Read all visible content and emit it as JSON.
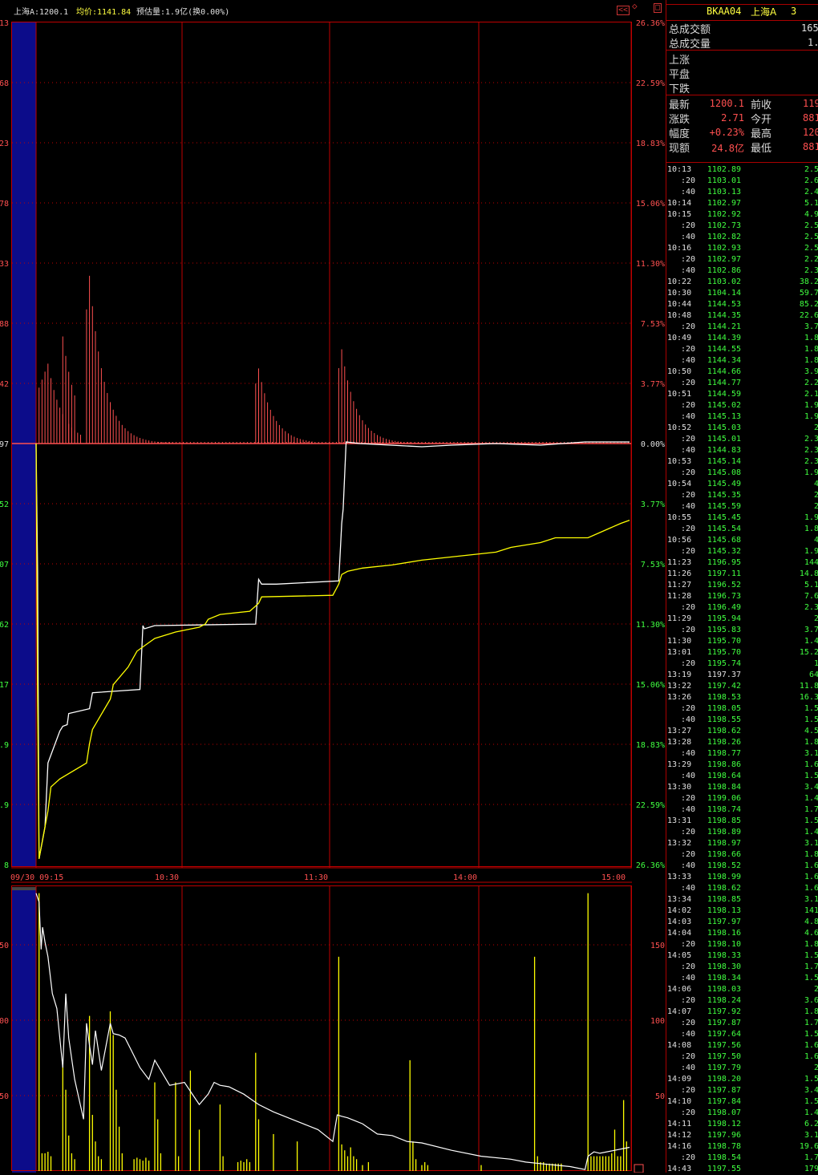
{
  "header": {
    "index_label": "上海A:1200.1",
    "avg_label": "均价:1141.84",
    "estimate_label": "预估量:1.9亿(换0.00%)",
    "collapse_btn": "<<",
    "toggle_btn": "◇",
    "max_btn": "□"
  },
  "colors": {
    "background": "#000000",
    "grid": "#c00000",
    "price_line": "#ffffff",
    "avg_line": "#ffff00",
    "up": "#ff5050",
    "down": "#40ff40",
    "highlight_band": "#0c0c8a"
  },
  "chart_data": [
    {
      "type": "line",
      "name": "price-chart",
      "x_ticks": [
        "09/30 09:15",
        "10:30",
        "11:30",
        "14:00",
        "15:00"
      ],
      "left_ticks": [
        "13",
        "68",
        "23",
        "78",
        "33",
        "88",
        "42",
        "97",
        "52",
        "07",
        "62",
        "17",
        ".9",
        ".9",
        "8"
      ],
      "right_ticks": [
        "26.36%",
        "22.59%",
        "18.83%",
        "15.06%",
        "11.30%",
        "7.53%",
        "3.77%",
        "0.00%",
        "3.77%",
        "7.53%",
        "11.30%",
        "15.06%",
        "18.83%",
        "22.59%",
        "26.36%"
      ],
      "right_tick_colors": [
        "up",
        "up",
        "up",
        "up",
        "up",
        "up",
        "up",
        "flat",
        "down",
        "down",
        "down",
        "down",
        "down",
        "down",
        "down"
      ],
      "pct_range": [
        -26.36,
        26.36
      ],
      "series": [
        {
          "role": "price",
          "t": [
            0,
            0.5,
            1,
            3,
            4,
            8,
            9,
            10.5,
            11,
            18,
            19,
            35,
            36,
            36.5,
            40,
            74,
            75,
            76,
            81,
            102,
            103,
            103.5,
            104.5,
            109,
            130,
            140,
            155,
            170,
            185,
            200
          ],
          "pct": [
            0,
            -8,
            -26,
            -24,
            -20,
            -18,
            -17.7,
            -17.6,
            -16.9,
            -16.6,
            -15.6,
            -15.4,
            -11.4,
            -11.6,
            -11.4,
            -11.3,
            -8.5,
            -8.8,
            -8.8,
            -8.6,
            -5.0,
            -4.1,
            0.1,
            0,
            -0.2,
            -0.1,
            0,
            -0.1,
            0.1,
            0.1
          ],
          "color": "white"
        },
        {
          "role": "average",
          "t": [
            0,
            0.5,
            1,
            4,
            5,
            8,
            17,
            18,
            19,
            25,
            25.5,
            26,
            31,
            34,
            37,
            40,
            47,
            55,
            57,
            58,
            62,
            72,
            75,
            76,
            100,
            102,
            103,
            105,
            110,
            120,
            130,
            145,
            155,
            160,
            170,
            175,
            182,
            186,
            197,
            200
          ],
          "pct": [
            0,
            -16,
            -26,
            -23,
            -21.5,
            -21,
            -20,
            -18.8,
            -17.9,
            -16,
            -15.6,
            -15.1,
            -14,
            -13,
            -12.6,
            -12.2,
            -11.8,
            -11.5,
            -11.3,
            -11.0,
            -10.7,
            -10.5,
            -10.0,
            -9.6,
            -9.5,
            -8.8,
            -8.2,
            -8.0,
            -7.8,
            -7.6,
            -7.3,
            -7.0,
            -6.8,
            -6.5,
            -6.2,
            -5.9,
            -5.9,
            -5.9,
            -5.0,
            -4.8
          ],
          "color": "yellow"
        },
        {
          "role": "breadth-bars",
          "groups": [
            {
              "t0": 1,
              "peak_t": 4,
              "peak": 5.0,
              "n": 15
            },
            {
              "t0": 9,
              "peak_t": 9,
              "peak": 6.7,
              "n": 5
            },
            {
              "t0": 17,
              "peak_t": 18,
              "peak": 10.5,
              "n": 30
            },
            {
              "t0": 74,
              "peak_t": 75,
              "peak": 4.7,
              "n": 20
            },
            {
              "t0": 102,
              "peak_t": 103,
              "peak": 5.9,
              "n": 25
            }
          ]
        }
      ]
    },
    {
      "type": "bar",
      "name": "volume-chart",
      "left_ticks": [
        "50",
        "00",
        "50"
      ],
      "right_ticks": [
        "150",
        "100",
        "50"
      ],
      "ylim": [
        0,
        190
      ],
      "volume_bars": [
        {
          "t": 1,
          "v": 188
        },
        {
          "t": 2,
          "v": 12
        },
        {
          "t": 3,
          "v": 12
        },
        {
          "t": 4,
          "v": 13
        },
        {
          "t": 5,
          "v": 10
        },
        {
          "t": 9,
          "v": 75
        },
        {
          "t": 10,
          "v": 55
        },
        {
          "t": 11,
          "v": 24
        },
        {
          "t": 12,
          "v": 12
        },
        {
          "t": 13,
          "v": 8
        },
        {
          "t": 18,
          "v": 105
        },
        {
          "t": 19,
          "v": 38
        },
        {
          "t": 20,
          "v": 20
        },
        {
          "t": 21,
          "v": 10
        },
        {
          "t": 22,
          "v": 8
        },
        {
          "t": 25,
          "v": 108
        },
        {
          "t": 26,
          "v": 92
        },
        {
          "t": 27,
          "v": 55
        },
        {
          "t": 28,
          "v": 30
        },
        {
          "t": 29,
          "v": 12
        },
        {
          "t": 33,
          "v": 8
        },
        {
          "t": 34,
          "v": 9
        },
        {
          "t": 35,
          "v": 8
        },
        {
          "t": 36,
          "v": 7
        },
        {
          "t": 37,
          "v": 9
        },
        {
          "t": 38,
          "v": 7
        },
        {
          "t": 40,
          "v": 60
        },
        {
          "t": 41,
          "v": 35
        },
        {
          "t": 42,
          "v": 12
        },
        {
          "t": 47,
          "v": 60
        },
        {
          "t": 48,
          "v": 10
        },
        {
          "t": 52,
          "v": 68
        },
        {
          "t": 55,
          "v": 28
        },
        {
          "t": 62,
          "v": 45
        },
        {
          "t": 63,
          "v": 10
        },
        {
          "t": 68,
          "v": 6
        },
        {
          "t": 69,
          "v": 7
        },
        {
          "t": 70,
          "v": 6
        },
        {
          "t": 71,
          "v": 8
        },
        {
          "t": 72,
          "v": 6
        },
        {
          "t": 74,
          "v": 80
        },
        {
          "t": 75,
          "v": 35
        },
        {
          "t": 80,
          "v": 25
        },
        {
          "t": 88,
          "v": 20
        },
        {
          "t": 102,
          "v": 145
        },
        {
          "t": 103,
          "v": 18
        },
        {
          "t": 104,
          "v": 14
        },
        {
          "t": 105,
          "v": 10
        },
        {
          "t": 106,
          "v": 16
        },
        {
          "t": 107,
          "v": 10
        },
        {
          "t": 108,
          "v": 8
        },
        {
          "t": 110,
          "v": 4
        },
        {
          "t": 112,
          "v": 6
        },
        {
          "t": 126,
          "v": 75
        },
        {
          "t": 127,
          "v": 20
        },
        {
          "t": 128,
          "v": 8
        },
        {
          "t": 130,
          "v": 4
        },
        {
          "t": 131,
          "v": 6
        },
        {
          "t": 132,
          "v": 4
        },
        {
          "t": 150,
          "v": 4
        },
        {
          "t": 168,
          "v": 145
        },
        {
          "t": 169,
          "v": 10
        },
        {
          "t": 170,
          "v": 6
        },
        {
          "t": 171,
          "v": 6
        },
        {
          "t": 172,
          "v": 5
        },
        {
          "t": 173,
          "v": 5
        },
        {
          "t": 174,
          "v": 5
        },
        {
          "t": 175,
          "v": 5
        },
        {
          "t": 176,
          "v": 5
        },
        {
          "t": 177,
          "v": 5
        },
        {
          "t": 186,
          "v": 188
        },
        {
          "t": 187,
          "v": 10
        },
        {
          "t": 188,
          "v": 10
        },
        {
          "t": 189,
          "v": 10
        },
        {
          "t": 190,
          "v": 10
        },
        {
          "t": 191,
          "v": 10
        },
        {
          "t": 192,
          "v": 10
        },
        {
          "t": 193,
          "v": 10
        },
        {
          "t": 194,
          "v": 12
        },
        {
          "t": 195,
          "v": 28
        },
        {
          "t": 196,
          "v": 10
        },
        {
          "t": 197,
          "v": 10
        },
        {
          "t": 198,
          "v": 48
        },
        {
          "t": 199,
          "v": 20
        }
      ],
      "vol_line": {
        "t": [
          0,
          1,
          1.7,
          2.2,
          3,
          4,
          5.5,
          7,
          9,
          10,
          11,
          13,
          16,
          17,
          18,
          19,
          20,
          22,
          25,
          26,
          28,
          30,
          32,
          35,
          38,
          40,
          45,
          50,
          55,
          58,
          60,
          62,
          65,
          67,
          70,
          75,
          80,
          90,
          95,
          100,
          101.5,
          103,
          105,
          110,
          115,
          120,
          125,
          130,
          140,
          150,
          160,
          165,
          170,
          180,
          185,
          186,
          188,
          190,
          195,
          200
        ],
        "v": [
          188,
          182,
          150,
          165,
          155,
          145,
          120,
          110,
          70,
          120,
          90,
          62,
          35,
          100,
          85,
          72,
          95,
          68,
          100,
          93,
          92,
          90,
          82,
          70,
          62,
          75,
          58,
          60,
          45,
          52,
          60,
          58,
          57,
          55,
          52,
          45,
          40,
          32,
          28,
          20,
          38,
          37,
          36,
          32,
          25,
          24,
          20,
          19,
          14,
          10,
          8,
          6,
          5,
          3,
          1,
          10,
          13,
          12,
          14,
          16
        ]
      }
    }
  ],
  "right_panel": {
    "code": "BKAA04",
    "market": "上海A",
    "page": "3",
    "total_amount_label": "总成交额",
    "total_amount_value": "165",
    "total_volume_label": "总成交量",
    "total_volume_value": "1.",
    "up_label": "上涨",
    "flat_label": "平盘",
    "down_label": "下跌",
    "quotes": [
      {
        "label": "最新",
        "value": "1200.1",
        "label2": "前收",
        "value2": "119"
      },
      {
        "label": "涨跌",
        "value": "2.71",
        "label2": "今开",
        "value2": "881"
      },
      {
        "label": "幅度",
        "value": "+0.23%",
        "label2": "最高",
        "value2": "120"
      },
      {
        "label": "现额",
        "value": "24.8亿",
        "label2": "最低",
        "value2": "881"
      }
    ],
    "ticks": [
      [
        "10:13",
        "1102.89",
        "2.5"
      ],
      [
        ":20",
        "1103.01",
        "2.6"
      ],
      [
        ":40",
        "1103.13",
        "2.4"
      ],
      [
        "10:14",
        "1102.97",
        "5.1"
      ],
      [
        "10:15",
        "1102.92",
        "4.9"
      ],
      [
        ":20",
        "1102.73",
        "2.5"
      ],
      [
        ":40",
        "1102.82",
        "2.5"
      ],
      [
        "10:16",
        "1102.93",
        "2.5"
      ],
      [
        ":20",
        "1102.97",
        "2.2"
      ],
      [
        ":40",
        "1102.86",
        "2.3"
      ],
      [
        "10:22",
        "1103.02",
        "38.2"
      ],
      [
        "10:30",
        "1104.14",
        "59.7"
      ],
      [
        "10:44",
        "1144.53",
        "85.2"
      ],
      [
        "10:48",
        "1144.35",
        "22.6"
      ],
      [
        ":20",
        "1144.21",
        "3.7"
      ],
      [
        "10:49",
        "1144.39",
        "1.8"
      ],
      [
        ":20",
        "1144.55",
        "1.8"
      ],
      [
        ":40",
        "1144.34",
        "1.8"
      ],
      [
        "10:50",
        "1144.66",
        "3.9"
      ],
      [
        ":20",
        "1144.77",
        "2.2"
      ],
      [
        "10:51",
        "1144.59",
        "2.1"
      ],
      [
        ":20",
        "1145.02",
        "1.9"
      ],
      [
        ":40",
        "1145.13",
        "1.9"
      ],
      [
        "10:52",
        "1145.03",
        "2"
      ],
      [
        ":20",
        "1145.01",
        "2.3"
      ],
      [
        ":40",
        "1144.83",
        "2.3"
      ],
      [
        "10:53",
        "1145.14",
        "2.3"
      ],
      [
        ":20",
        "1145.08",
        "1.9"
      ],
      [
        "10:54",
        "1145.49",
        "4"
      ],
      [
        ":20",
        "1145.35",
        "2"
      ],
      [
        ":40",
        "1145.59",
        "2"
      ],
      [
        "10:55",
        "1145.45",
        "1.9"
      ],
      [
        ":20",
        "1145.54",
        "1.8"
      ],
      [
        "10:56",
        "1145.68",
        "4"
      ],
      [
        ":20",
        "1145.32",
        "1.9"
      ],
      [
        "11:23",
        "1196.95",
        "144"
      ],
      [
        "11:26",
        "1197.11",
        "14.8"
      ],
      [
        "11:27",
        "1196.52",
        "5.1"
      ],
      [
        "11:28",
        "1196.73",
        "7.6"
      ],
      [
        ":20",
        "1196.49",
        "2.3"
      ],
      [
        "11:29",
        "1195.94",
        "2"
      ],
      [
        ":20",
        "1195.83",
        "3.7"
      ],
      [
        "11:30",
        "1195.70",
        "1.4"
      ],
      [
        "13:01",
        "1195.70",
        "15.2"
      ],
      [
        ":20",
        "1195.74",
        "1"
      ],
      [
        "13:19",
        "1197.37",
        "64"
      ],
      [
        "13:22",
        "1197.42",
        "11.8"
      ],
      [
        "13:26",
        "1198.53",
        "16.3"
      ],
      [
        ":20",
        "1198.05",
        "1.5"
      ],
      [
        ":40",
        "1198.55",
        "1.5"
      ],
      [
        "13:27",
        "1198.62",
        "4.5"
      ],
      [
        "13:28",
        "1198.26",
        "1.8"
      ],
      [
        ":40",
        "1198.77",
        "3.1"
      ],
      [
        "13:29",
        "1198.86",
        "1.6"
      ],
      [
        ":40",
        "1198.64",
        "1.5"
      ],
      [
        "13:30",
        "1198.84",
        "3.4"
      ],
      [
        ":20",
        "1199.06",
        "1.4"
      ],
      [
        ":40",
        "1198.74",
        "1.7"
      ],
      [
        "13:31",
        "1198.85",
        "1.5"
      ],
      [
        ":20",
        "1198.89",
        "1.4"
      ],
      [
        "13:32",
        "1198.97",
        "3.1"
      ],
      [
        ":20",
        "1198.66",
        "1.8"
      ],
      [
        ":40",
        "1198.52",
        "1.6"
      ],
      [
        "13:33",
        "1198.99",
        "1.6"
      ],
      [
        ":40",
        "1198.62",
        "1.6"
      ],
      [
        "13:34",
        "1198.85",
        "3.1"
      ],
      [
        "14:02",
        "1198.13",
        "141"
      ],
      [
        "14:03",
        "1197.97",
        "4.8"
      ],
      [
        "14:04",
        "1198.16",
        "4.6"
      ],
      [
        ":20",
        "1198.10",
        "1.8"
      ],
      [
        "14:05",
        "1198.33",
        "1.5"
      ],
      [
        ":20",
        "1198.30",
        "1.7"
      ],
      [
        ":40",
        "1198.34",
        "1.5"
      ],
      [
        "14:06",
        "1198.03",
        "2"
      ],
      [
        ":20",
        "1198.24",
        "3.6"
      ],
      [
        "14:07",
        "1197.92",
        "1.8"
      ],
      [
        ":20",
        "1197.87",
        "1.7"
      ],
      [
        ":40",
        "1197.64",
        "1.5"
      ],
      [
        "14:08",
        "1197.56",
        "1.6"
      ],
      [
        ":20",
        "1197.50",
        "1.6"
      ],
      [
        ":40",
        "1197.79",
        "2"
      ],
      [
        "14:09",
        "1198.20",
        "1.5"
      ],
      [
        ":20",
        "1197.87",
        "3.4"
      ],
      [
        "14:10",
        "1197.84",
        "1.5"
      ],
      [
        ":20",
        "1198.07",
        "1.4"
      ],
      [
        "14:11",
        "1198.12",
        "6.2"
      ],
      [
        "14:12",
        "1197.96",
        "3.1"
      ],
      [
        "14:16",
        "1198.78",
        "19.6"
      ],
      [
        ":20",
        "1198.54",
        "1.7"
      ],
      [
        "14:43",
        "1197.55",
        "179"
      ]
    ],
    "tick_colors": [
      "up",
      "up",
      "up",
      "up",
      "up",
      "up",
      "up",
      "up",
      "up",
      "up",
      "up",
      "up",
      "up",
      "up",
      "up",
      "up",
      "up",
      "up",
      "up",
      "up",
      "up",
      "up",
      "up",
      "up",
      "up",
      "up",
      "up",
      "up",
      "up",
      "up",
      "up",
      "up",
      "up",
      "up",
      "up",
      "up",
      "up",
      "up",
      "up",
      "up",
      "up",
      "up",
      "up",
      "up",
      "up",
      "white",
      "up",
      "up",
      "up",
      "up",
      "up",
      "up",
      "up",
      "up",
      "up",
      "up",
      "up",
      "up",
      "up",
      "up",
      "up",
      "up",
      "up",
      "up",
      "up",
      "up",
      "up",
      "up",
      "up",
      "up",
      "up",
      "up",
      "up",
      "up",
      "up",
      "up",
      "up",
      "up",
      "up",
      "up",
      "up",
      "up",
      "up",
      "up",
      "up",
      "up",
      "up",
      "up",
      "up",
      "up",
      "up",
      "up"
    ]
  }
}
